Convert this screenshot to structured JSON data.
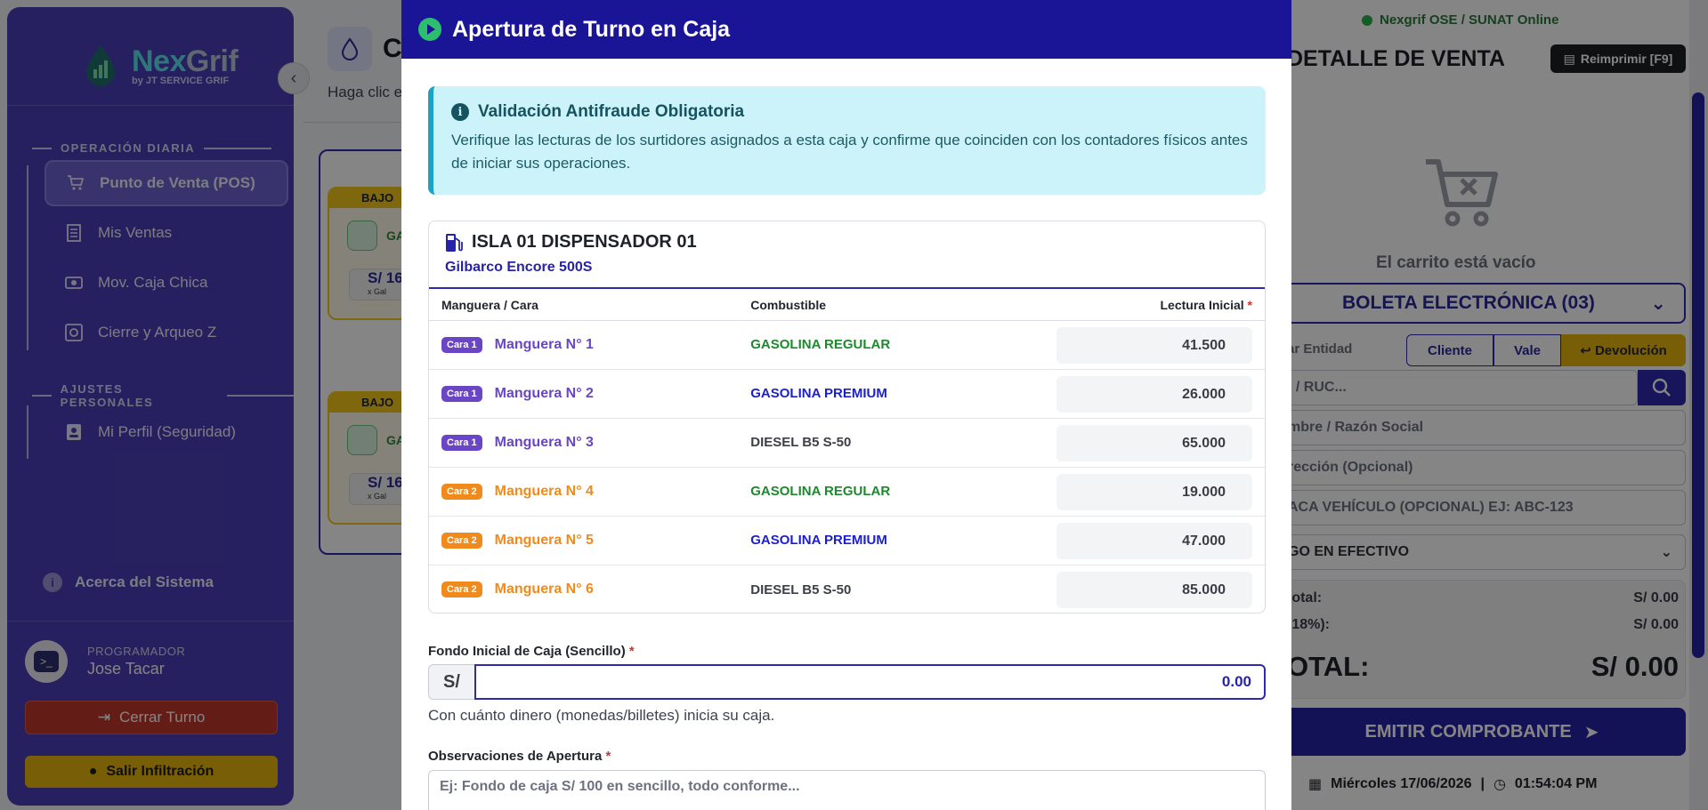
{
  "sidebar": {
    "brand_nex": "Nex",
    "brand_grif": "Grif",
    "brand_sub": "by JT SERVICE GRIF",
    "section_daily": "OPERACIÓN DIARIA",
    "items_daily": [
      "Punto de Venta (POS)",
      "Mis Ventas",
      "Mov. Caja Chica",
      "Cierre y Arqueo Z"
    ],
    "section_personal": "AJUSTES PERSONALES",
    "item_profile": "Mi Perfil (Seguridad)",
    "about": "Acerca del Sistema",
    "user_role": "PROGRAMADOR",
    "user_name": "Jose Tacar",
    "btn_close_shift": "Cerrar Turno",
    "btn_exit": "Salir Infiltración"
  },
  "page": {
    "title_initial": "C",
    "hint": "Haga clic e",
    "card_tag": "BAJO",
    "card_label": "GA",
    "card_price": "S/ 16",
    "card_unit": "x Gal"
  },
  "right_panel": {
    "status": "Nexgrif OSE / SUNAT Online",
    "title": "DETALLE DE VENTA",
    "reprint": "Reimprimir [F9]",
    "cart_empty": "El carrito está vacío",
    "doc_type": "BOLETA ELECTRÓNICA (03)",
    "entity_label": "ar Entidad",
    "seg_cliente": "Cliente",
    "seg_vale": "Vale",
    "seg_devolucion": "Devolución",
    "doc_placeholder": "I / RUC...",
    "name_placeholder": "mbre / Razón Social",
    "address_placeholder": "rección (Opcional)",
    "plate_placeholder": "ACA VEHÍCULO (OPCIONAL) EJ: ABC-123",
    "payment": "GO EN EFECTIVO",
    "subtotal_label": "total:",
    "subtotal_value": "S/ 0.00",
    "igv_label": "(18%):",
    "igv_value": "S/ 0.00",
    "total_label": "OTAL:",
    "total_value": "S/ 0.00",
    "emit": "EMITIR COMPROBANTE",
    "date": "Miércoles 17/06/2026",
    "time": "01:54:04 PM"
  },
  "modal": {
    "title": "Apertura de Turno en Caja",
    "alert_title": "Validación Antifraude Obligatoria",
    "alert_text": "Verifique las lecturas de los surtidores asignados a esta caja y confirme que coinciden con los contadores físicos antes de iniciar sus operaciones.",
    "dispenser_title": "ISLA 01 DISPENSADOR 01",
    "dispenser_model": "Gilbarco Encore 500S",
    "col_hose": "Manguera / Cara",
    "col_fuel": "Combustible",
    "col_reading": "Lectura Inicial",
    "required_mark": "*",
    "rows": [
      {
        "cara": "Cara 1",
        "hose": "Manguera N° 1",
        "fuel": "GASOLINA REGULAR",
        "reading": "41.500"
      },
      {
        "cara": "Cara 1",
        "hose": "Manguera N° 2",
        "fuel": "GASOLINA PREMIUM",
        "reading": "26.000"
      },
      {
        "cara": "Cara 1",
        "hose": "Manguera N° 3",
        "fuel": "DIESEL B5 S-50",
        "reading": "65.000"
      },
      {
        "cara": "Cara 2",
        "hose": "Manguera N° 4",
        "fuel": "GASOLINA REGULAR",
        "reading": "19.000"
      },
      {
        "cara": "Cara 2",
        "hose": "Manguera N° 5",
        "fuel": "GASOLINA PREMIUM",
        "reading": "47.000"
      },
      {
        "cara": "Cara 2",
        "hose": "Manguera N° 6",
        "fuel": "DIESEL B5 S-50",
        "reading": "85.000"
      }
    ],
    "fund_label": "Fondo Inicial de Caja (Sencillo)",
    "fund_prefix": "S/",
    "fund_value": "0.00",
    "fund_hint": "Con cuánto dinero (monedas/billetes) inicia su caja.",
    "obs_label": "Observaciones de Apertura",
    "obs_placeholder": "Ej: Fondo de caja S/ 100 en sencillo, todo conforme..."
  },
  "colors": {
    "primary": "#1a1496",
    "sidebar": "#4b3fb8",
    "cara1": "#6a45c4",
    "cara2": "#f08a1c",
    "regular": "#1c8a2c",
    "premium": "#1b1fd0",
    "alert_bg": "#cdf3fa"
  }
}
